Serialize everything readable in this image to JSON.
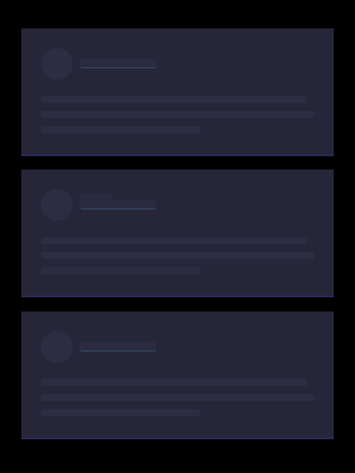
{
  "cards": [
    {
      "avatar": "avatar-placeholder",
      "state": "loading"
    },
    {
      "avatar": "avatar-placeholder",
      "state": "loading"
    },
    {
      "avatar": "avatar-placeholder",
      "state": "loading"
    }
  ]
}
